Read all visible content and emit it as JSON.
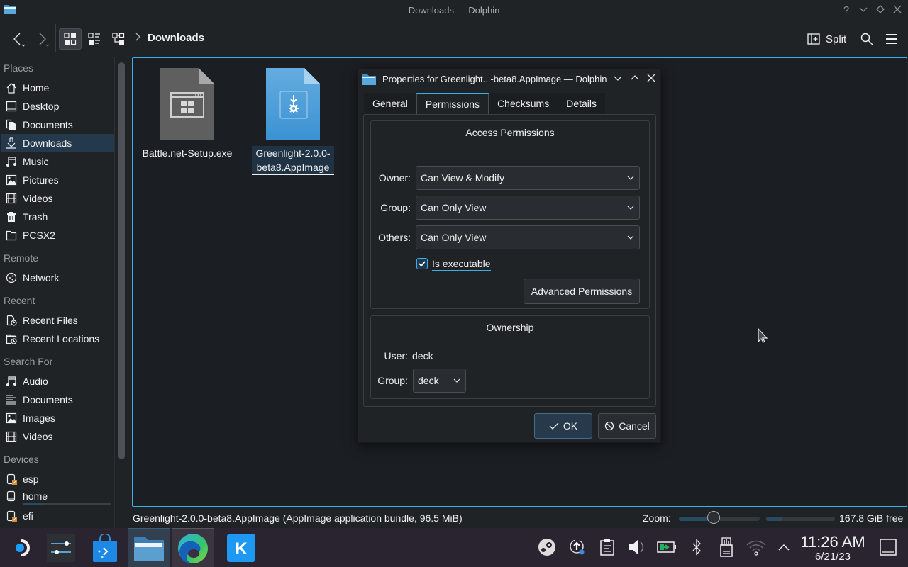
{
  "window": {
    "title": "Downloads — Dolphin"
  },
  "toolbar": {
    "breadcrumb": "Downloads",
    "split_label": "Split"
  },
  "sidebar": {
    "sections": [
      {
        "title": "Places",
        "items": [
          {
            "label": "Home",
            "icon": "home-icon"
          },
          {
            "label": "Desktop",
            "icon": "desktop-icon"
          },
          {
            "label": "Documents",
            "icon": "documents-icon"
          },
          {
            "label": "Downloads",
            "icon": "downloads-icon",
            "selected": true
          },
          {
            "label": "Music",
            "icon": "music-icon"
          },
          {
            "label": "Pictures",
            "icon": "pictures-icon"
          },
          {
            "label": "Videos",
            "icon": "videos-icon"
          },
          {
            "label": "Trash",
            "icon": "trash-icon"
          },
          {
            "label": "PCSX2",
            "icon": "folder-icon"
          }
        ]
      },
      {
        "title": "Remote",
        "items": [
          {
            "label": "Network",
            "icon": "network-icon"
          }
        ]
      },
      {
        "title": "Recent",
        "items": [
          {
            "label": "Recent Files",
            "icon": "recent-files-icon"
          },
          {
            "label": "Recent Locations",
            "icon": "recent-locations-icon"
          }
        ]
      },
      {
        "title": "Search For",
        "items": [
          {
            "label": "Audio",
            "icon": "audio-icon"
          },
          {
            "label": "Documents",
            "icon": "text-documents-icon"
          },
          {
            "label": "Images",
            "icon": "images-icon"
          },
          {
            "label": "Videos",
            "icon": "video-search-icon"
          }
        ]
      },
      {
        "title": "Devices",
        "items": [
          {
            "label": "esp",
            "icon": "drive-icon"
          },
          {
            "label": "home",
            "icon": "drive-icon"
          },
          {
            "label": "efi",
            "icon": "drive-icon"
          }
        ]
      }
    ],
    "home_usage_fraction": 0.22
  },
  "files": [
    {
      "name": "Battle.net-Setup.exe",
      "type": "exe"
    },
    {
      "name_line1": "Greenlight-2.0.0-",
      "name_line2": "beta8.AppImage",
      "type": "appimage",
      "selected": true
    }
  ],
  "statusbar": {
    "text": "Greenlight-2.0.0-beta8.AppImage (AppImage application bundle, 96.5 MiB)",
    "zoom_label": "Zoom:",
    "zoom_fraction": 0.44,
    "disk_used_fraction": 0.24,
    "free_space": "167.8 GiB free"
  },
  "dialog": {
    "title": "Properties for Greenlight...-beta8.AppImage — Dolphin",
    "tabs": [
      "General",
      "Permissions",
      "Checksums",
      "Details"
    ],
    "active_tab": "Permissions",
    "access": {
      "title": "Access Permissions",
      "owner_label": "Owner:",
      "owner_value": "Can View & Modify",
      "group_label": "Group:",
      "group_value": "Can Only View",
      "others_label": "Others:",
      "others_value": "Can Only View",
      "executable_label": "Is executable",
      "executable_checked": true,
      "advanced_button": "Advanced Permissions"
    },
    "ownership": {
      "title": "Ownership",
      "user_label": "User:",
      "user_value": "deck",
      "group_label": "Group:",
      "group_value": "deck"
    },
    "ok_label": "OK",
    "cancel_label": "Cancel"
  },
  "taskbar": {
    "apps": [
      "steam-deck-menu",
      "system-settings",
      "discover",
      "dolphin",
      "edge",
      "kde"
    ],
    "clock_time": "11:26 AM",
    "clock_date": "6/21/23"
  }
}
